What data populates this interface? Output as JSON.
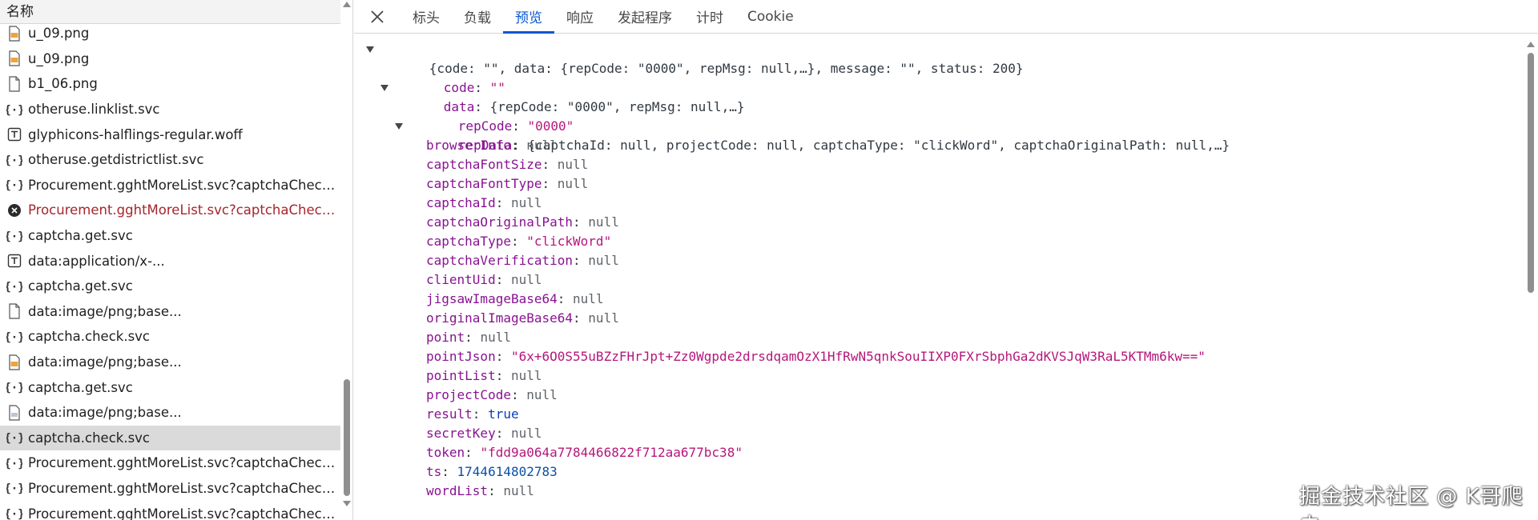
{
  "request_list": {
    "header": "名称",
    "rows": [
      {
        "label": "u_09.png",
        "icon": "png-file-icon"
      },
      {
        "label": "u_09.png",
        "icon": "png-file-icon"
      },
      {
        "label": "b1_06.png",
        "icon": "file-icon"
      },
      {
        "label": "otheruse.linklist.svc",
        "icon": "braces-icon"
      },
      {
        "label": "glyphicons-halflings-regular.woff",
        "icon": "font-icon"
      },
      {
        "label": "otheruse.getdistrictlist.svc",
        "icon": "braces-icon"
      },
      {
        "label": "Procurement.gghtMoreList.svc?captchaCheckF...",
        "icon": "braces-icon"
      },
      {
        "label": "Procurement.gghtMoreList.svc?captchaCheckF...",
        "icon": "error-icon",
        "status": "error"
      },
      {
        "label": "captcha.get.svc",
        "icon": "braces-icon"
      },
      {
        "label": "data:application/x-...",
        "icon": "font-icon"
      },
      {
        "label": "captcha.get.svc",
        "icon": "braces-icon"
      },
      {
        "label": "data:image/png;base...",
        "icon": "file-icon"
      },
      {
        "label": "captcha.check.svc",
        "icon": "braces-icon"
      },
      {
        "label": "data:image/png;base...",
        "icon": "png-file-icon"
      },
      {
        "label": "captcha.get.svc",
        "icon": "braces-icon"
      },
      {
        "label": "data:image/png;base...",
        "icon": "image-file-icon"
      },
      {
        "label": "captcha.check.svc",
        "icon": "braces-icon",
        "selected": true
      },
      {
        "label": "Procurement.gghtMoreList.svc?captchaCheckF...",
        "icon": "braces-icon"
      },
      {
        "label": "Procurement.gghtMoreList.svc?captchaCheckF...",
        "icon": "braces-icon"
      },
      {
        "label": "Procurement.gghtMoreList.svc?captchaCheckF...",
        "icon": "braces-icon"
      }
    ]
  },
  "detail": {
    "tabs": [
      "标头",
      "负载",
      "预览",
      "响应",
      "发起程序",
      "计时",
      "Cookie"
    ],
    "active_tab": "预览"
  },
  "preview": {
    "root_summary": "{code: \"\", data: {repCode: \"0000\", repMsg: null,…}, message: \"\", status: 200}",
    "code": "\"\"",
    "data_summary": "{repCode: \"0000\", repMsg: null,…}",
    "repCode": "\"0000\"",
    "repData_summary": "{captchaId: null, projectCode: null, captchaType: \"clickWord\", captchaOriginalPath: null,…}",
    "fields": [
      {
        "key": "browserInfo",
        "value": "null",
        "type": "null"
      },
      {
        "key": "captchaFontSize",
        "value": "null",
        "type": "null"
      },
      {
        "key": "captchaFontType",
        "value": "null",
        "type": "null"
      },
      {
        "key": "captchaId",
        "value": "null",
        "type": "null"
      },
      {
        "key": "captchaOriginalPath",
        "value": "null",
        "type": "null"
      },
      {
        "key": "captchaType",
        "value": "\"clickWord\"",
        "type": "str"
      },
      {
        "key": "captchaVerification",
        "value": "null",
        "type": "null"
      },
      {
        "key": "clientUid",
        "value": "null",
        "type": "null"
      },
      {
        "key": "jigsawImageBase64",
        "value": "null",
        "type": "null"
      },
      {
        "key": "originalImageBase64",
        "value": "null",
        "type": "null"
      },
      {
        "key": "point",
        "value": "null",
        "type": "null"
      },
      {
        "key": "pointJson",
        "value": "\"6x+6O0S55uBZzFHrJpt+Zz0Wgpde2drsdqamOzX1HfRwN5qnkSouIIXP0FXrSbphGa2dKVSJqW3RaL5KTMm6kw==\"",
        "type": "str"
      },
      {
        "key": "pointList",
        "value": "null",
        "type": "null"
      },
      {
        "key": "projectCode",
        "value": "null",
        "type": "null"
      },
      {
        "key": "result",
        "value": "true",
        "type": "bool"
      },
      {
        "key": "secretKey",
        "value": "null",
        "type": "null"
      },
      {
        "key": "token",
        "value": "\"fdd9a064a7784466822f712aa677bc38\"",
        "type": "str"
      },
      {
        "key": "ts",
        "value": "1744614802783",
        "type": "num"
      },
      {
        "key": "wordList",
        "value": "null",
        "type": "null"
      }
    ],
    "repMsg": "null"
  },
  "watermark": "掘金技术社区 @ K哥爬虫"
}
